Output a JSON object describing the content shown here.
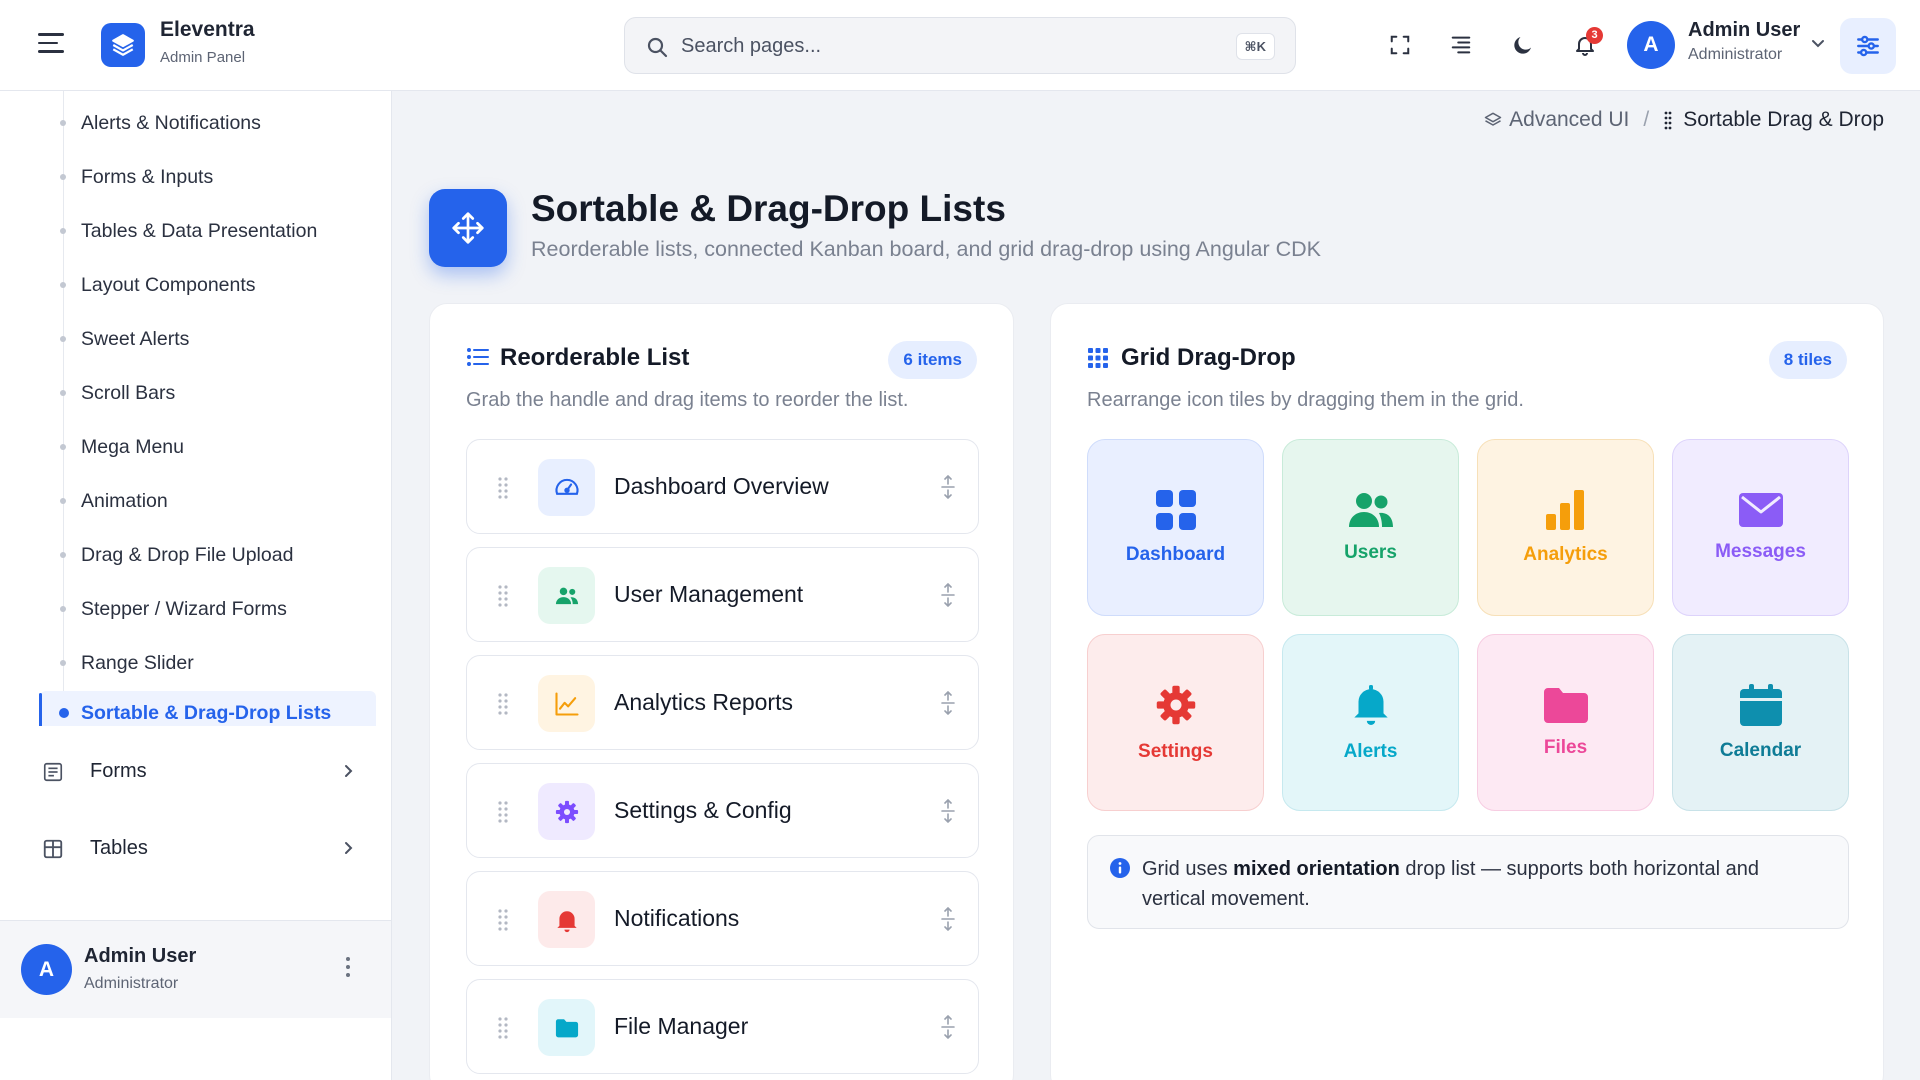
{
  "header": {
    "brand_name": "Eleventra",
    "brand_sub": "Admin Panel",
    "search_placeholder": "Search pages...",
    "search_shortcut": "⌘K",
    "notification_count": "3",
    "user_initial": "A",
    "user_name": "Admin User",
    "user_role": "Administrator"
  },
  "sidebar": {
    "submenu_items": [
      {
        "label": "Alerts & Notifications"
      },
      {
        "label": "Forms & Inputs"
      },
      {
        "label": "Tables & Data Presentation"
      },
      {
        "label": "Layout Components"
      },
      {
        "label": "Sweet Alerts"
      },
      {
        "label": "Scroll Bars"
      },
      {
        "label": "Mega Menu"
      },
      {
        "label": "Animation"
      },
      {
        "label": "Drag & Drop File Upload"
      },
      {
        "label": "Stepper / Wizard Forms"
      },
      {
        "label": "Range Slider"
      },
      {
        "label": "Sortable & Drag-Drop Lists"
      }
    ],
    "active_item": "Sortable & Drag-Drop Lists",
    "groups": [
      {
        "label": "Forms",
        "icon": "form-icon"
      },
      {
        "label": "Tables",
        "icon": "table-icon"
      }
    ],
    "footer": {
      "initial": "A",
      "name": "Admin User",
      "role": "Administrator"
    }
  },
  "breadcrumb": {
    "parent": "Advanced UI",
    "separator": "/",
    "current": "Sortable Drag & Drop"
  },
  "page": {
    "title": "Sortable & Drag-Drop Lists",
    "subtitle": "Reorderable lists, connected Kanban board, and grid drag-drop using Angular CDK"
  },
  "reorder_card": {
    "title": "Reorderable List",
    "badge": "6 items",
    "description": "Grab the handle and drag items to reorder the list.",
    "items": [
      {
        "label": "Dashboard Overview",
        "icon": "gauge-icon",
        "color": "#2563eb",
        "bg": "#e8efff"
      },
      {
        "label": "User Management",
        "icon": "users-icon",
        "color": "#16a36a",
        "bg": "#e5f7ef"
      },
      {
        "label": "Analytics Reports",
        "icon": "chart-line-icon",
        "color": "#f59e0b",
        "bg": "#fff4e2"
      },
      {
        "label": "Settings & Config",
        "icon": "gear-icon",
        "color": "#7c4dff",
        "bg": "#efeaff"
      },
      {
        "label": "Notifications",
        "icon": "bell-icon",
        "color": "#e53935",
        "bg": "#fdeaea"
      },
      {
        "label": "File Manager",
        "icon": "folder-icon",
        "color": "#06a8c9",
        "bg": "#e2f6fa"
      }
    ]
  },
  "grid_card": {
    "title": "Grid Drag-Drop",
    "badge": "8 tiles",
    "description": "Rearrange icon tiles by dragging them in the grid.",
    "tiles": [
      {
        "label": "Dashboard",
        "icon": "grid-icon",
        "color": "#2563eb",
        "bg": "#e9efff"
      },
      {
        "label": "Users",
        "icon": "users-icon",
        "color": "#16a36a",
        "bg": "#e6f6ee"
      },
      {
        "label": "Analytics",
        "icon": "bar-chart-icon",
        "color": "#f59e0b",
        "bg": "#fef3e2"
      },
      {
        "label": "Messages",
        "icon": "envelope-icon",
        "color": "#8b5cf6",
        "bg": "#f1ecff"
      },
      {
        "label": "Settings",
        "icon": "gear-icon",
        "color": "#e53935",
        "bg": "#fdecec"
      },
      {
        "label": "Alerts",
        "icon": "bell-icon",
        "color": "#06a8c9",
        "bg": "#e3f6f9"
      },
      {
        "label": "Files",
        "icon": "folder-icon",
        "color": "#ec4899",
        "bg": "#fde9f3"
      },
      {
        "label": "Calendar",
        "icon": "calendar-icon",
        "color": "#0e7c96",
        "bg": "#e4f2f5"
      }
    ],
    "info": {
      "prefix": "Grid uses ",
      "emphasis": "mixed orientation",
      "suffix": " drop list — supports both horizontal and vertical movement."
    }
  }
}
